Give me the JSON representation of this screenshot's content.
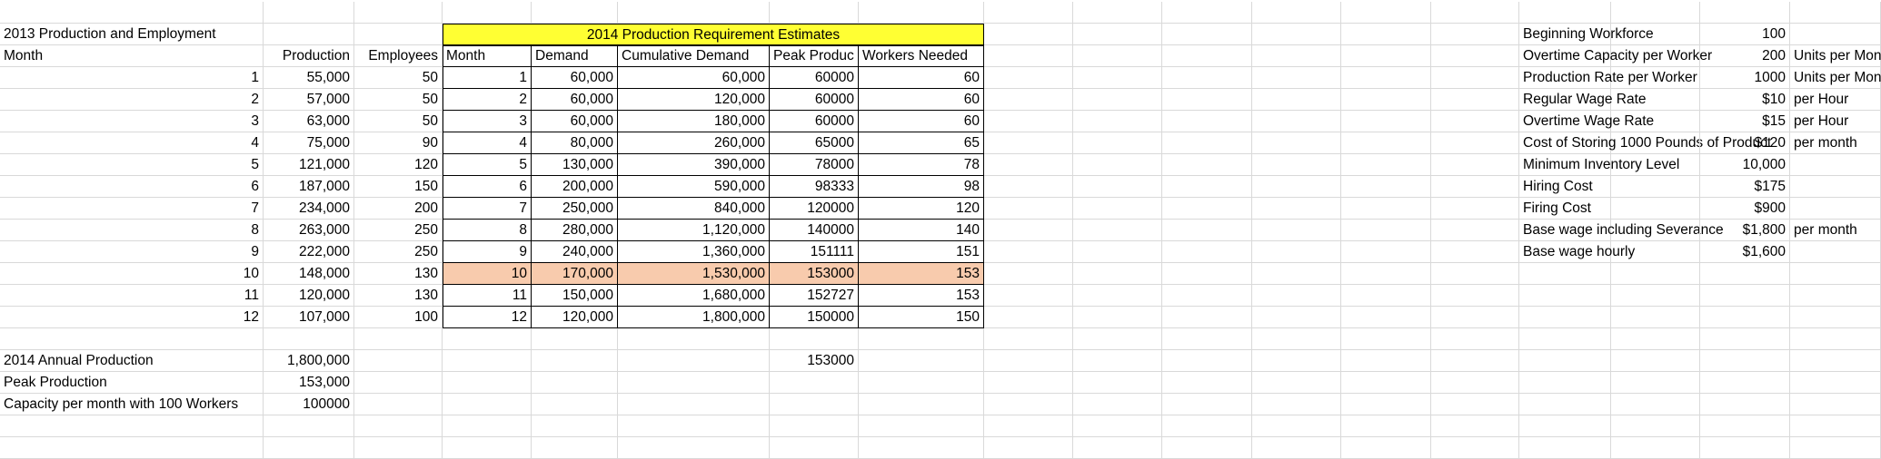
{
  "production_employment": {
    "title": "2013 Production and Employment",
    "header_month": "Month",
    "header_production": "Production",
    "header_employees": "Employees",
    "rows": [
      {
        "month": "1",
        "production": "55,000",
        "employees": "50"
      },
      {
        "month": "2",
        "production": "57,000",
        "employees": "50"
      },
      {
        "month": "3",
        "production": "63,000",
        "employees": "50"
      },
      {
        "month": "4",
        "production": "75,000",
        "employees": "90"
      },
      {
        "month": "5",
        "production": "121,000",
        "employees": "120"
      },
      {
        "month": "6",
        "production": "187,000",
        "employees": "150"
      },
      {
        "month": "7",
        "production": "234,000",
        "employees": "200"
      },
      {
        "month": "8",
        "production": "263,000",
        "employees": "250"
      },
      {
        "month": "9",
        "production": "222,000",
        "employees": "250"
      },
      {
        "month": "10",
        "production": "148,000",
        "employees": "130"
      },
      {
        "month": "11",
        "production": "120,000",
        "employees": "130"
      },
      {
        "month": "12",
        "production": "107,000",
        "employees": "100"
      }
    ]
  },
  "requirement_estimates": {
    "title": "2014 Production Requirement Estimates",
    "header_month": "Month",
    "header_demand": "Demand",
    "header_cumulative": "Cumulative Demand",
    "header_peak": "Peak Produc",
    "header_workers": "Workers Needed",
    "rows": [
      {
        "month": "1",
        "demand": "60,000",
        "cumulative": "60,000",
        "peak": "60000",
        "workers": "60"
      },
      {
        "month": "2",
        "demand": "60,000",
        "cumulative": "120,000",
        "peak": "60000",
        "workers": "60"
      },
      {
        "month": "3",
        "demand": "60,000",
        "cumulative": "180,000",
        "peak": "60000",
        "workers": "60"
      },
      {
        "month": "4",
        "demand": "80,000",
        "cumulative": "260,000",
        "peak": "65000",
        "workers": "65"
      },
      {
        "month": "5",
        "demand": "130,000",
        "cumulative": "390,000",
        "peak": "78000",
        "workers": "78"
      },
      {
        "month": "6",
        "demand": "200,000",
        "cumulative": "590,000",
        "peak": "98333",
        "workers": "98"
      },
      {
        "month": "7",
        "demand": "250,000",
        "cumulative": "840,000",
        "peak": "120000",
        "workers": "120"
      },
      {
        "month": "8",
        "demand": "280,000",
        "cumulative": "1,120,000",
        "peak": "140000",
        "workers": "140"
      },
      {
        "month": "9",
        "demand": "240,000",
        "cumulative": "1,360,000",
        "peak": "151111",
        "workers": "151"
      },
      {
        "month": "10",
        "demand": "170,000",
        "cumulative": "1,530,000",
        "peak": "153000",
        "workers": "153"
      },
      {
        "month": "11",
        "demand": "150,000",
        "cumulative": "1,680,000",
        "peak": "152727",
        "workers": "153"
      },
      {
        "month": "12",
        "demand": "120,000",
        "cumulative": "1,800,000",
        "peak": "150000",
        "workers": "150"
      }
    ],
    "highlight_month": "10",
    "peak_total": "153000"
  },
  "summary": {
    "annual_production_label": "2014 Annual Production",
    "annual_production_value": "1,800,000",
    "peak_production_label": "Peak Production",
    "peak_production_value": "153,000",
    "capacity_label": "Capacity per month with 100 Workers",
    "capacity_value": "100000"
  },
  "parameters": [
    {
      "label": "Beginning Workforce",
      "value": "100",
      "unit": ""
    },
    {
      "label": "Overtime Capacity per Worker",
      "value": "200",
      "unit": "Units per Month"
    },
    {
      "label": "Production Rate per Worker",
      "value": "1000",
      "unit": "Units per Month"
    },
    {
      "label": "Regular Wage Rate",
      "value": "$10",
      "unit": "per Hour"
    },
    {
      "label": "Overtime Wage Rate",
      "value": "$15",
      "unit": "per Hour"
    },
    {
      "label": "Cost of Storing 1000 Pounds of Product",
      "value": "$120",
      "unit": "per month"
    },
    {
      "label": "Minimum Inventory Level",
      "value": "10,000",
      "unit": ""
    },
    {
      "label": "Hiring Cost",
      "value": "$175",
      "unit": ""
    },
    {
      "label": "Firing Cost",
      "value": "$900",
      "unit": ""
    },
    {
      "label": "Base wage including Severance",
      "value": "$1,800",
      "unit": "per month"
    },
    {
      "label": "Base wage hourly",
      "value": "$1,600",
      "unit": ""
    }
  ],
  "colors": {
    "title_fill": "#ffff33",
    "highlight_fill": "#f8cbad",
    "gridline": "#d9d9d9",
    "border": "#000000"
  }
}
